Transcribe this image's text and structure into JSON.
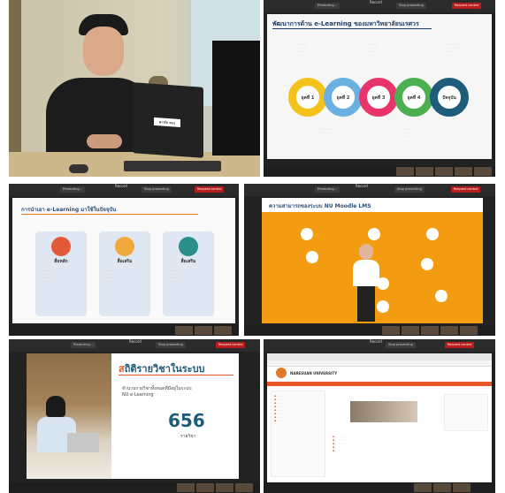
{
  "app": {
    "window_title": "Record"
  },
  "controls": {
    "presenting": "Presenting...",
    "stop_presenting": "Stop presenting",
    "request_control": "Request control"
  },
  "slides": {
    "s1": {
      "title": "พัฒนาการด้าน e-Learning ของมหาวิทยาลัยนเรศวร",
      "eras": [
        {
          "label": "ยุคที่ 1",
          "color": "#f4c21c"
        },
        {
          "label": "ยุคที่ 2",
          "color": "#6ab0e0"
        },
        {
          "label": "ยุคที่ 3",
          "color": "#e8336b"
        },
        {
          "label": "ยุคที่ 4",
          "color": "#4caf50"
        },
        {
          "label": "ปัจจุบัน",
          "color": "#1f5b7a"
        }
      ]
    },
    "s2": {
      "title": "การนำเอา e-Learning มาใช้ในปัจจุบัน",
      "cards": [
        {
          "label": "สื่อหลัก"
        },
        {
          "label": "สื่อเสริม"
        },
        {
          "label": "สื่อเสริม"
        }
      ]
    },
    "s3": {
      "title": "ความสามารถของระบบ NU Moodle LMS"
    },
    "s4": {
      "heading_first": "ส",
      "heading_rest": "ถิติรายวิชาในระบบ",
      "sub1": "จำนวนรายวิชาทั้งหมดที่มีอยู่ในระบบ",
      "sub2": "NU e-Learning",
      "count": "656",
      "unit": "รายวิชา"
    },
    "s5": {
      "site_name": "NARESUAN UNIVERSITY"
    }
  },
  "photo": {
    "sign_text": "ศุภชัย ทอง"
  }
}
